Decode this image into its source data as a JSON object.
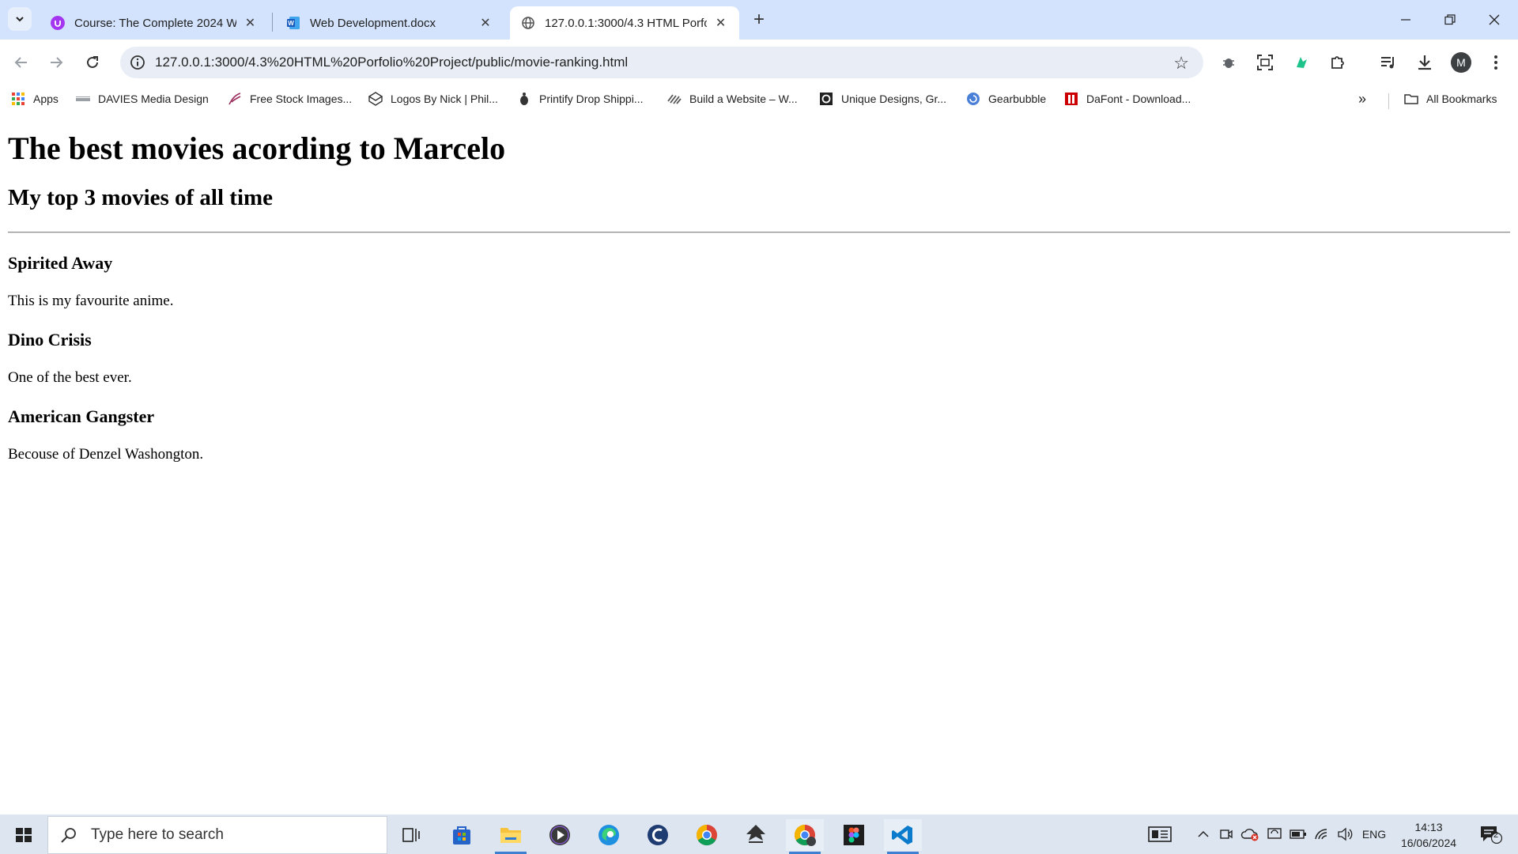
{
  "browser": {
    "tabs": [
      {
        "title": "Course: The Complete 2024 We",
        "favicon": "udemy-icon",
        "active": false
      },
      {
        "title": "Web Development.docx",
        "favicon": "word-icon",
        "active": false
      },
      {
        "title": "127.0.0.1:3000/4.3 HTML Porfoli",
        "favicon": "globe-icon",
        "active": true
      }
    ],
    "address": "127.0.0.1:3000/4.3%20HTML%20Porfolio%20Project/public/movie-ranking.html",
    "profile_initial": "M",
    "bookmarks": [
      {
        "label": "Apps",
        "icon": "apps-grid-icon"
      },
      {
        "label": "DAVIES Media Design",
        "icon": "davies-icon"
      },
      {
        "label": "Free Stock Images...",
        "icon": "feather-icon"
      },
      {
        "label": "Logos By Nick | Phil...",
        "icon": "cube-icon"
      },
      {
        "label": "Printify Drop Shippi...",
        "icon": "printify-icon"
      },
      {
        "label": "Build a Website – W...",
        "icon": "wix-icon"
      },
      {
        "label": "Unique Designs, Gr...",
        "icon": "designs-icon"
      },
      {
        "label": "Gearbubble",
        "icon": "gearbubble-icon"
      },
      {
        "label": "DaFont - Download...",
        "icon": "dafont-icon"
      }
    ],
    "all_bookmarks_label": "All Bookmarks"
  },
  "page": {
    "heading": "The best movies acording to Marcelo",
    "subheading": "My top 3 movies of all time",
    "movies": [
      {
        "title": "Spirited Away",
        "comment": "This is my favourite anime."
      },
      {
        "title": "Dino Crisis",
        "comment": "One of the best ever."
      },
      {
        "title": "American Gangster",
        "comment": "Becouse of Denzel Washongton."
      }
    ]
  },
  "taskbar": {
    "search_placeholder": "Type here to search",
    "language": "ENG",
    "time": "14:13",
    "date": "16/06/2024",
    "notification_count": "2"
  }
}
